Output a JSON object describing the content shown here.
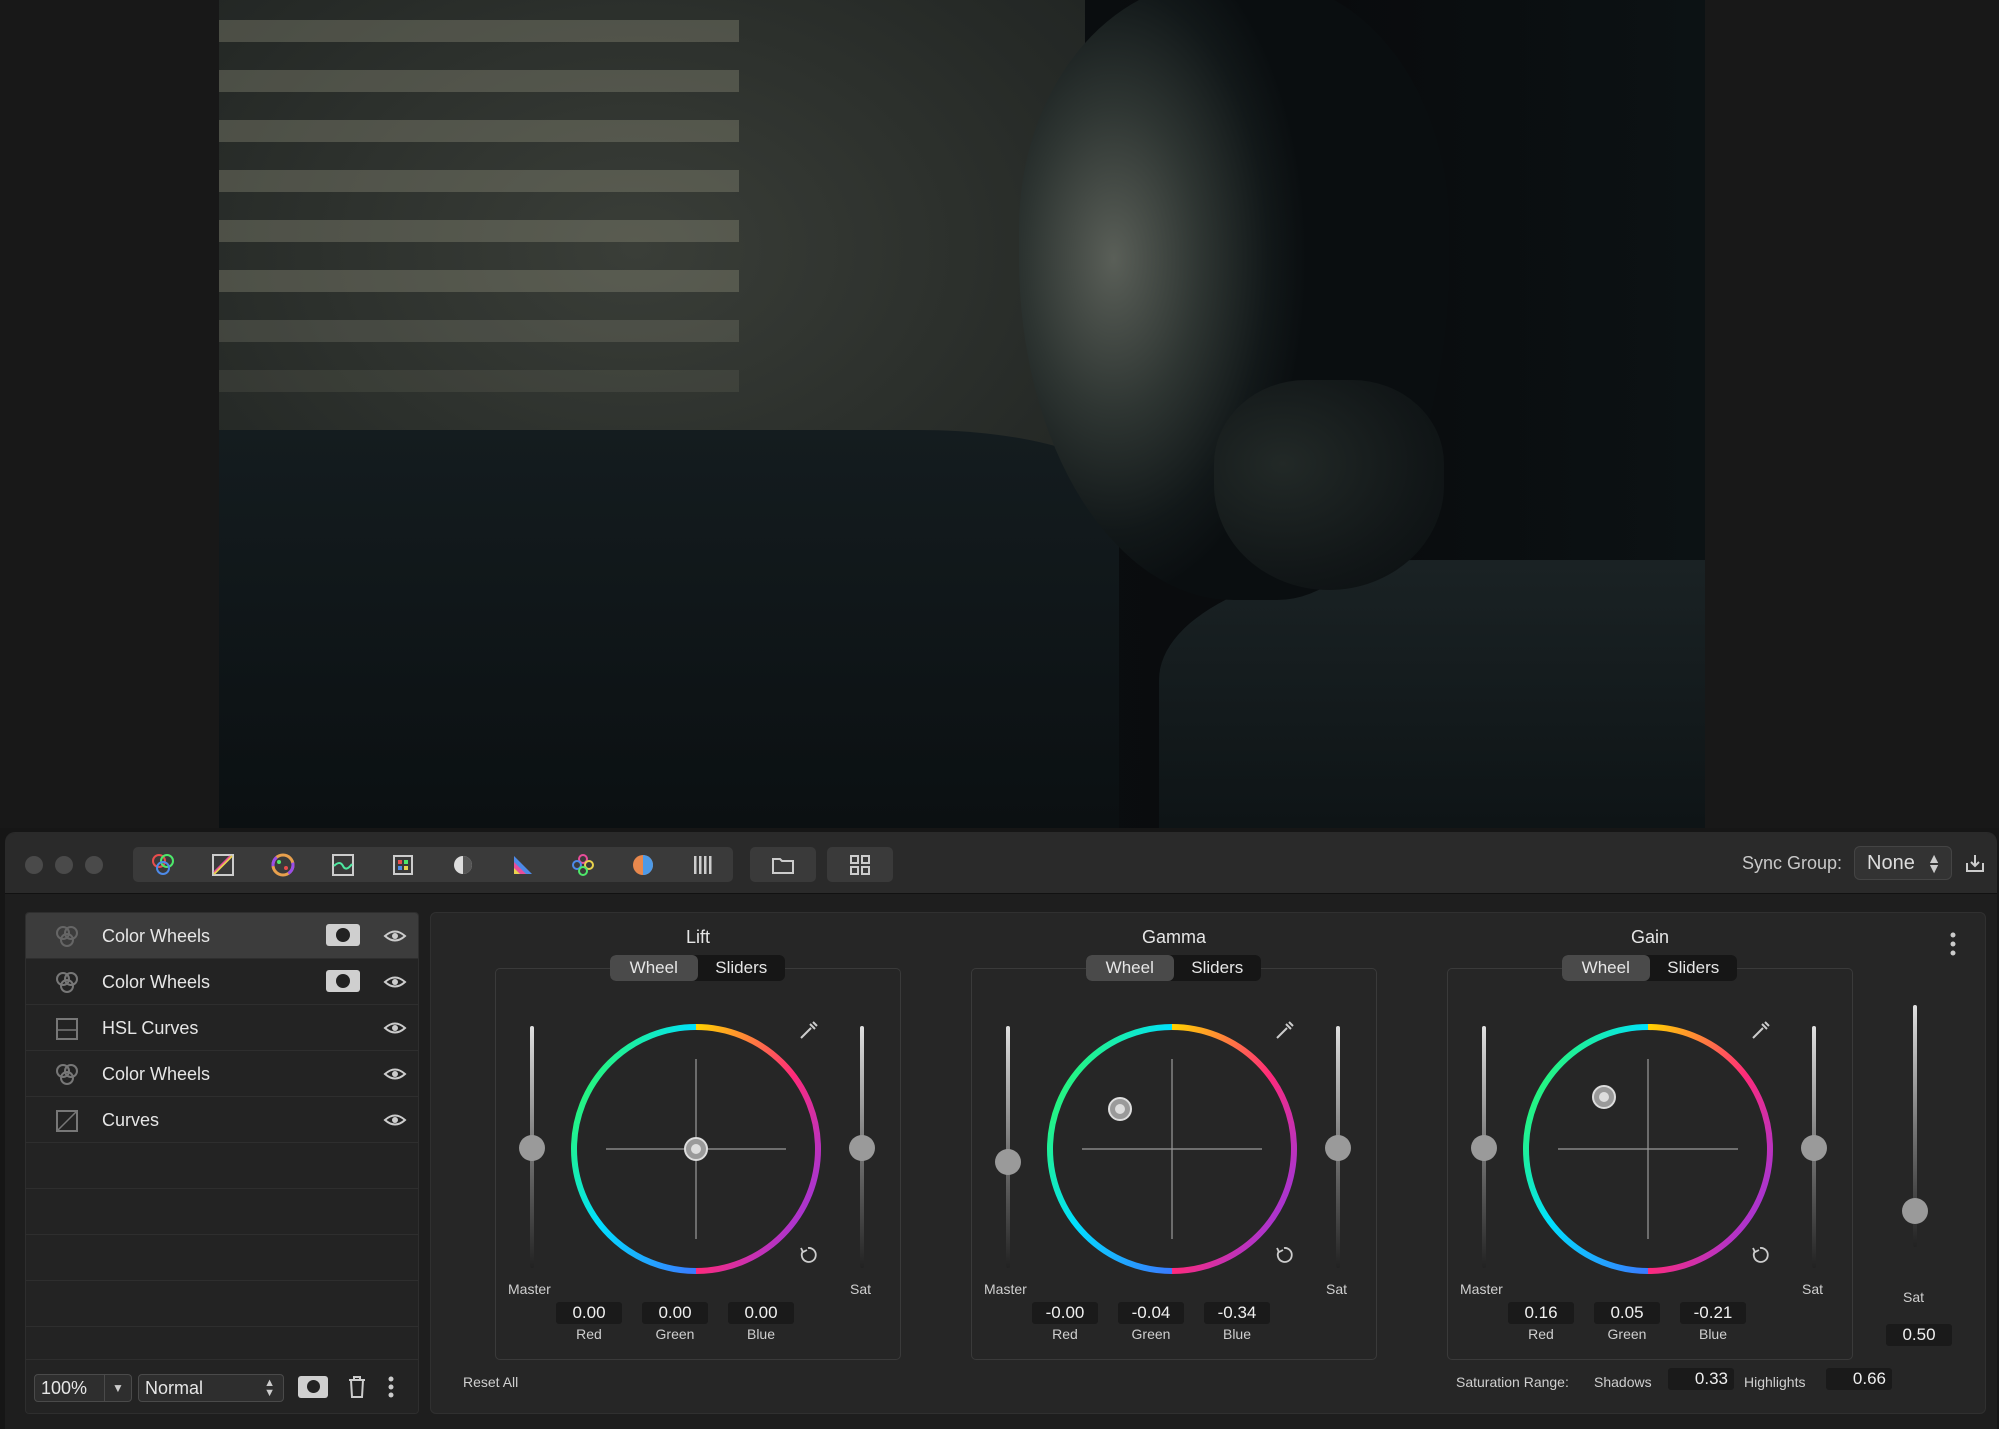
{
  "toolbar": {
    "tools": [
      "color-wheels-icon",
      "curves-icon",
      "hsl-wheel-icon",
      "hsl-curves-icon",
      "lut-icon",
      "exposure-icon",
      "chart-icon",
      "color-mixer-icon",
      "color-balance-icon",
      "bars-icon"
    ],
    "folder_icon": "folder-icon",
    "grid_icon": "grid-icon",
    "sync_label": "Sync Group:",
    "sync_value": "None"
  },
  "layers": {
    "items": [
      {
        "name": "Color Wheels",
        "icon": "color-wheels-icon",
        "mask": true,
        "selected": true
      },
      {
        "name": "Color Wheels",
        "icon": "color-wheels-icon",
        "mask": true,
        "selected": false
      },
      {
        "name": "HSL Curves",
        "icon": "hsl-curves-icon",
        "mask": false,
        "selected": false
      },
      {
        "name": "Color Wheels",
        "icon": "color-wheels-icon",
        "mask": false,
        "selected": false
      },
      {
        "name": "Curves",
        "icon": "curves-icon",
        "mask": false,
        "selected": false
      }
    ],
    "zoom": "100%",
    "blend_mode": "Normal"
  },
  "wheels": [
    {
      "title": "Lift",
      "wheel_label": "Wheel",
      "sliders_label": "Sliders",
      "master_label": "Master",
      "sat_label": "Sat",
      "red": "0.00",
      "green": "0.00",
      "blue": "0.00",
      "red_label": "Red",
      "green_label": "Green",
      "blue_label": "Blue"
    },
    {
      "title": "Gamma",
      "wheel_label": "Wheel",
      "sliders_label": "Sliders",
      "master_label": "Master",
      "sat_label": "Sat",
      "red": "-0.00",
      "green": "-0.04",
      "blue": "-0.34",
      "red_label": "Red",
      "green_label": "Green",
      "blue_label": "Blue"
    },
    {
      "title": "Gain",
      "wheel_label": "Wheel",
      "sliders_label": "Sliders",
      "master_label": "Master",
      "sat_label": "Sat",
      "red": "0.16",
      "green": "0.05",
      "blue": "-0.21",
      "red_label": "Red",
      "green_label": "Green",
      "blue_label": "Blue"
    }
  ],
  "global": {
    "sat_label": "Sat",
    "sat_value": "0.50",
    "reset_all": "Reset All",
    "saturation_range_label": "Saturation Range:",
    "shadows_label": "Shadows",
    "shadows_value": "0.33",
    "highlights_label": "Highlights",
    "highlights_value": "0.66"
  }
}
